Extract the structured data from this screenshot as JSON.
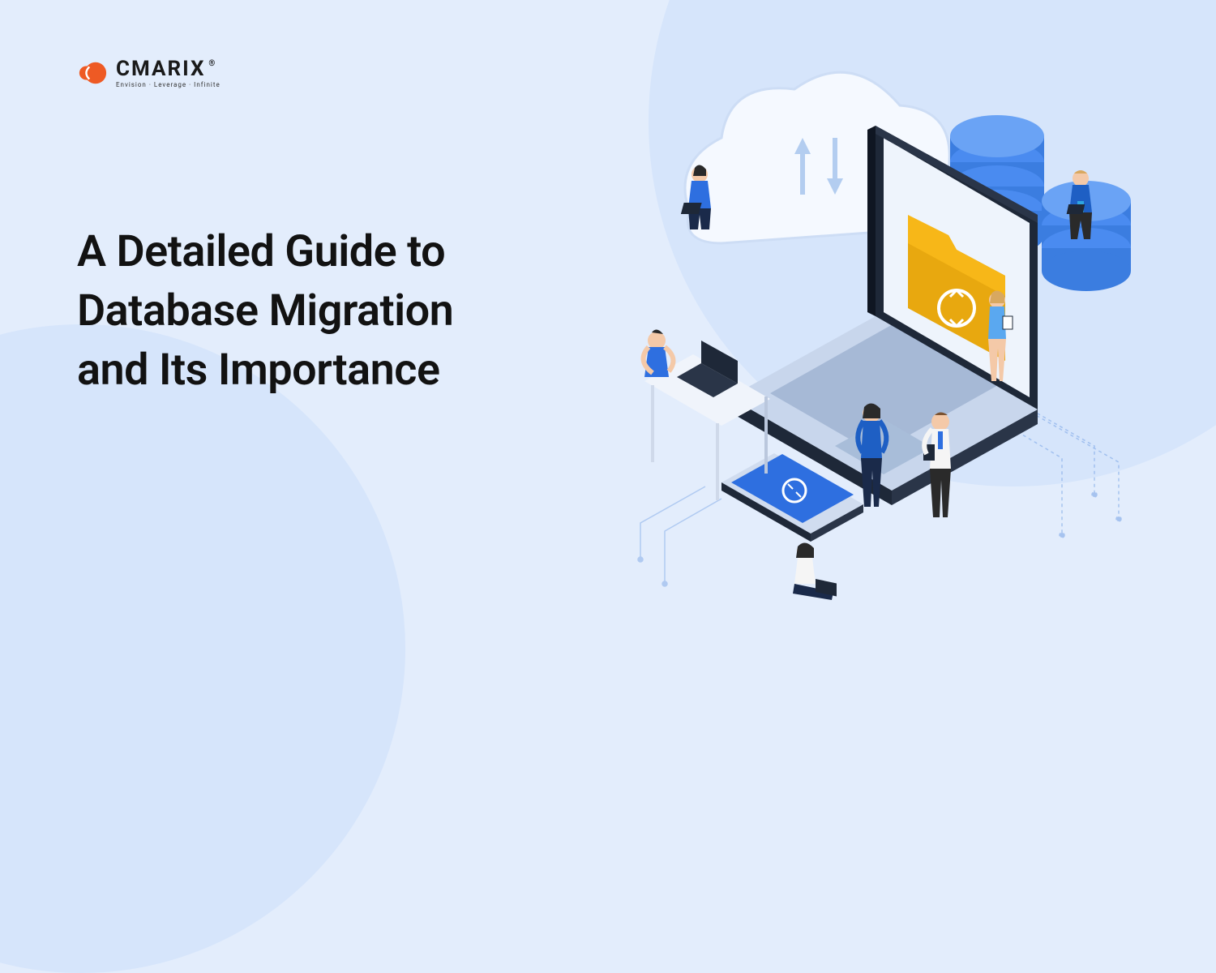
{
  "brand": {
    "name": "CMARIX",
    "tagline": "Envision · Leverage · Infinite",
    "registered": "®"
  },
  "headline": "A Detailed Guide to\nDatabase Migration\nand Its Importance",
  "illustration": {
    "alt": "Isometric illustration showing cloud, laptop with sync folder, database cylinders, phone, and people working"
  },
  "colors": {
    "bg": "#e3edfc",
    "bg_accent": "#d6e5fb",
    "accent_blue": "#2e6fe0",
    "accent_yellow": "#f7b718",
    "accent_orange": "#ee5a24",
    "text": "#121212"
  }
}
